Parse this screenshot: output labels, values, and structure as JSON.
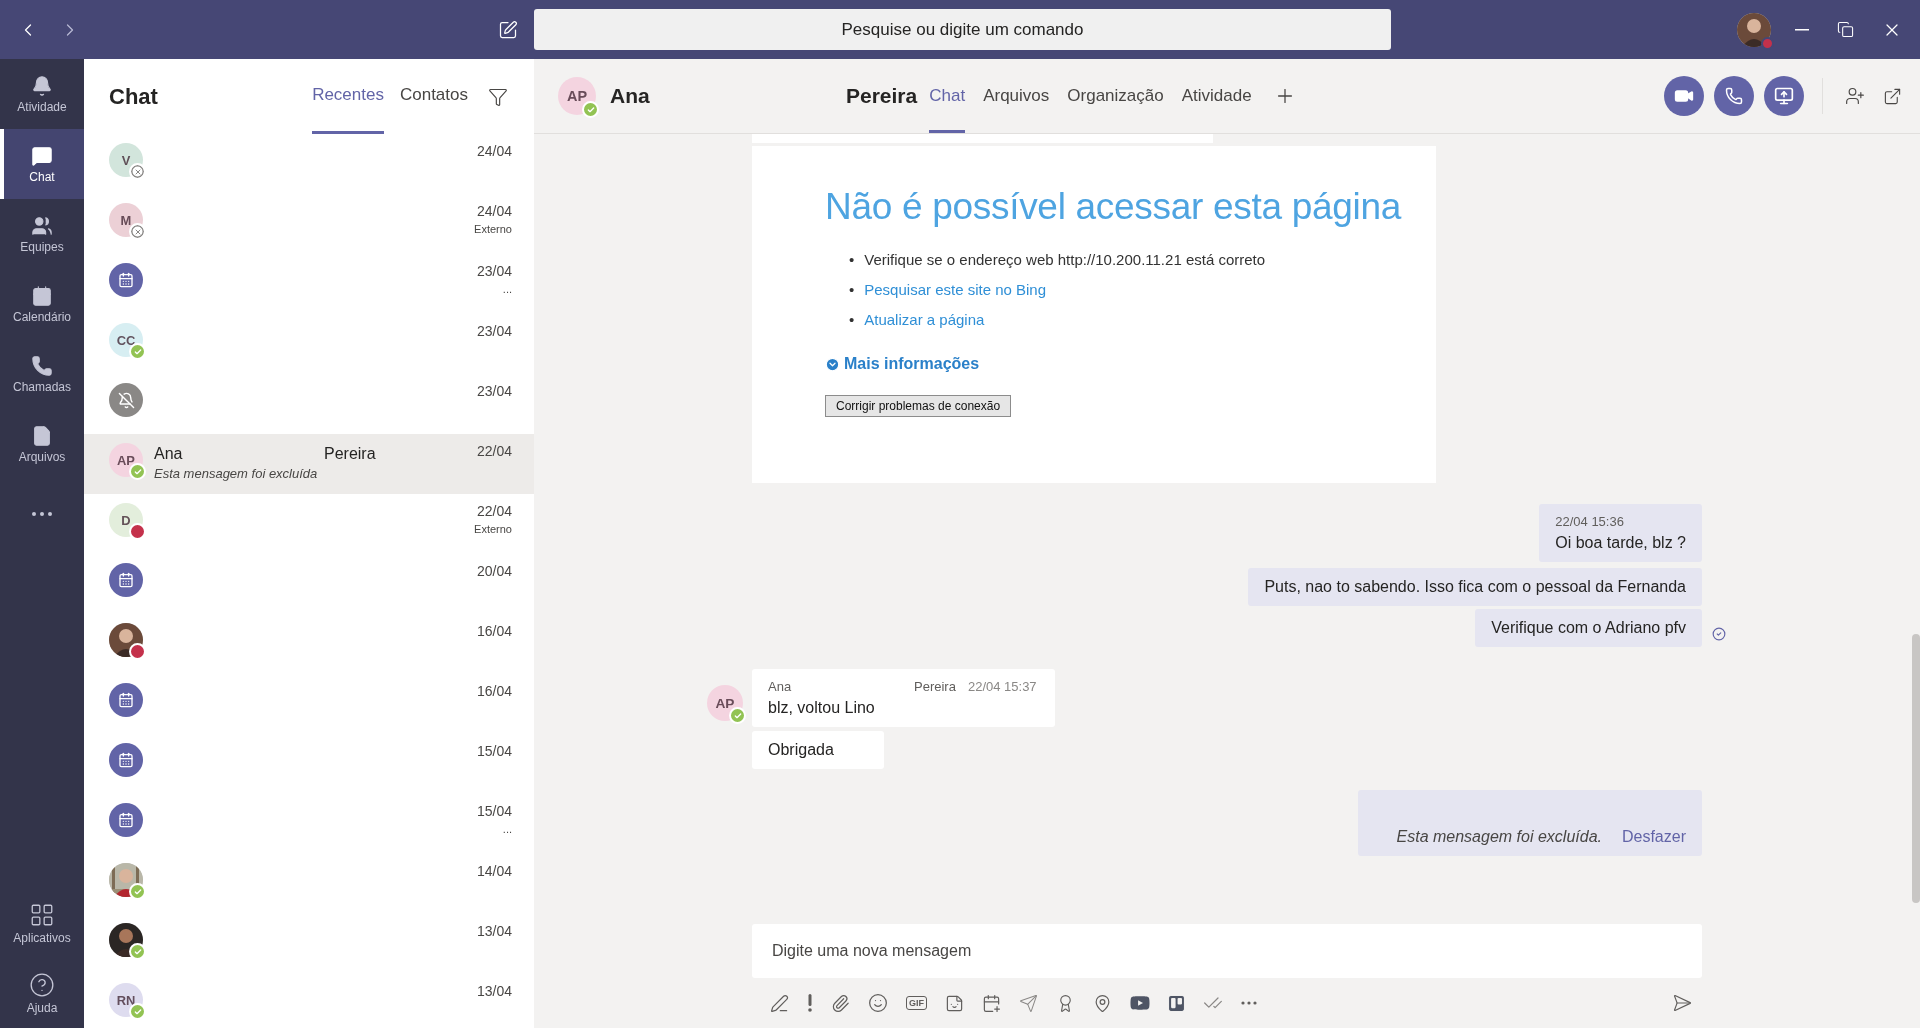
{
  "search": {
    "placeholder": "Pesquise ou digite um comando"
  },
  "rail": {
    "items": [
      {
        "label": "Atividade",
        "selected": false
      },
      {
        "label": "Chat",
        "selected": true
      },
      {
        "label": "Equipes",
        "selected": false
      },
      {
        "label": "Calendário",
        "selected": false
      },
      {
        "label": "Chamadas",
        "selected": false
      },
      {
        "label": "Arquivos",
        "selected": false
      }
    ],
    "bottom_items": [
      {
        "label": "Aplicativos"
      },
      {
        "label": "Ajuda"
      }
    ]
  },
  "chat_list": {
    "title": "Chat",
    "tabs": [
      {
        "label": "Recentes",
        "selected": true
      },
      {
        "label": "Contatos",
        "selected": false
      }
    ],
    "rows": [
      {
        "kind": "initials",
        "initials": "V",
        "color": "#d2e5dc",
        "status": {
          "kind": "offline"
        },
        "date": "24/04",
        "selected": false
      },
      {
        "kind": "initials",
        "initials": "M",
        "color": "#ecd0d6",
        "status": {
          "kind": "offline"
        },
        "date": "24/04",
        "note": "Externo",
        "selected": false
      },
      {
        "kind": "meeting",
        "date": "23/04",
        "note": "...",
        "selected": false
      },
      {
        "kind": "initials",
        "initials": "CC",
        "color": "#d7eef2",
        "status": {
          "kind": "available"
        },
        "date": "23/04",
        "selected": false
      },
      {
        "kind": "muted",
        "date": "23/04",
        "selected": false
      },
      {
        "kind": "initials",
        "initials": "AP",
        "color": "#f4d4e0",
        "status": {
          "kind": "available"
        },
        "name": "Ana",
        "surname": "Pereira",
        "preview": "Esta mensagem foi excluída",
        "date": "22/04",
        "selected": true
      },
      {
        "kind": "initials",
        "initials": "D",
        "color": "#e3eedc",
        "status": {
          "kind": "busy"
        },
        "date": "22/04",
        "note": "Externo",
        "selected": false
      },
      {
        "kind": "meeting",
        "date": "20/04",
        "selected": false
      },
      {
        "status": {
          "kind": "busy"
        },
        "date": "16/04",
        "selected": false
      },
      {
        "kind": "meeting",
        "date": "16/04",
        "selected": false
      },
      {
        "kind": "meeting",
        "date": "15/04",
        "selected": false
      },
      {
        "kind": "meeting",
        "date": "15/04",
        "note": "...",
        "selected": false
      },
      {
        "status": {
          "kind": "available"
        },
        "date": "14/04",
        "selected": false
      },
      {
        "status": {
          "kind": "available"
        },
        "date": "13/04",
        "selected": false
      },
      {
        "kind": "initials",
        "initials": "RN",
        "color": "#dedcef",
        "status": {
          "kind": "available"
        },
        "date": "13/04",
        "selected": false
      }
    ]
  },
  "conversation": {
    "header": {
      "initials": "AP",
      "color": "#f4d4e0",
      "status": {
        "kind": "available"
      },
      "name": "Ana",
      "surname": "Pereira",
      "tabs": [
        {
          "label": "Chat",
          "selected": true
        },
        {
          "label": "Arquivos",
          "selected": false
        },
        {
          "label": "Organização",
          "selected": false
        },
        {
          "label": "Atividade",
          "selected": false
        }
      ]
    },
    "preview": {
      "title": "Não é possível acessar esta página",
      "bullets": [
        {
          "kind": "text",
          "marker": "•",
          "text": "Verifique se o endereço web http://10.200.11.21 está correto"
        },
        {
          "kind": "link",
          "marker": "•",
          "text": "Pesquisar este site no Bing"
        },
        {
          "kind": "link",
          "marker": "•",
          "text": "Atualizar a página"
        }
      ],
      "more_info": "Mais informações",
      "button": "Corrigir problemas de conexão"
    },
    "messages": [
      {
        "kind": "outgoing",
        "time": "22/04 15:36",
        "text": "Oi boa tarde, blz ?",
        "read": false
      },
      {
        "kind": "outgoing",
        "text": "Puts, nao to sabendo. Isso fica com o pessoal da Fernanda",
        "read": false
      },
      {
        "kind": "outgoing",
        "text": "Verifique com o Adriano pfv",
        "read": true
      },
      {
        "kind": "incoming",
        "initials": "AP",
        "color": "#f4d4e0",
        "status": {
          "kind": "available"
        },
        "author": "Ana",
        "surname": "Pereira",
        "time": "22/04 15:37",
        "text": "blz, voltou Lino"
      },
      {
        "kind": "incoming",
        "text": "Obrigada"
      },
      {
        "kind": "deleted",
        "text": "Esta mensagem foi excluída.",
        "action": "Desfazer"
      }
    ],
    "composer": {
      "placeholder": "Digite uma nova mensagem",
      "gif_label": "GIF"
    }
  }
}
